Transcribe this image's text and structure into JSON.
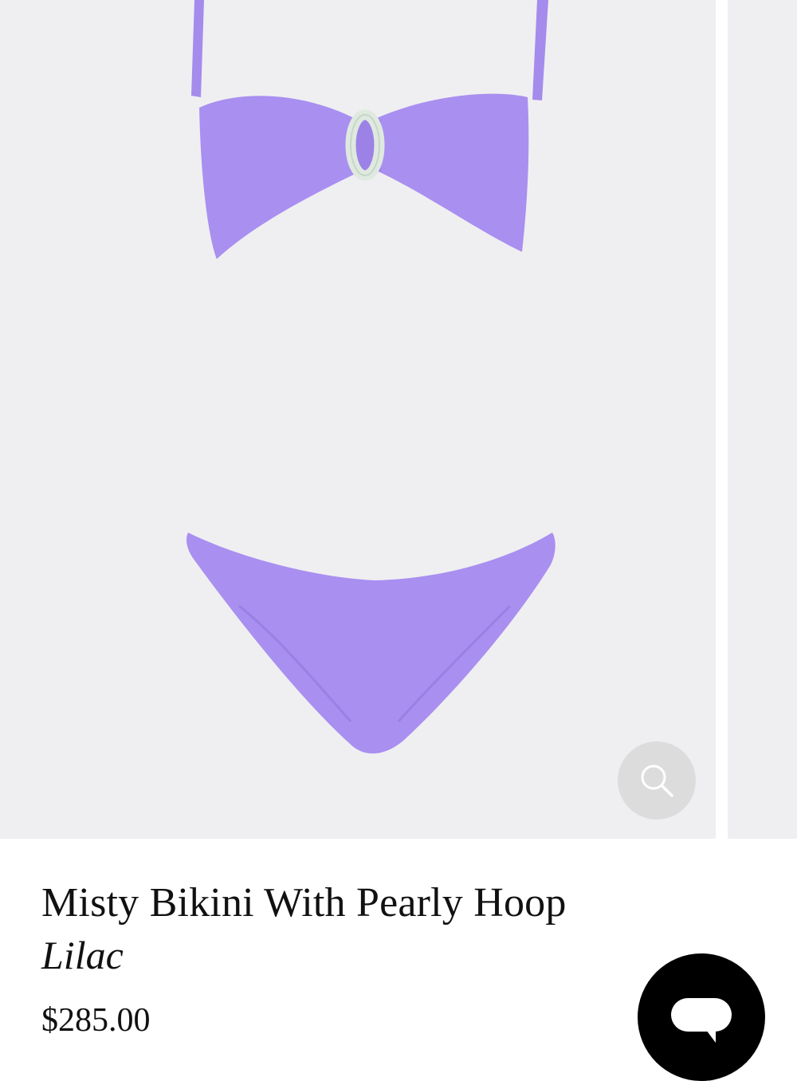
{
  "product": {
    "title": "Misty Bikini With Pearly Hoop",
    "color_name": "Lilac",
    "price": "$285.00"
  },
  "gallery": {
    "background_color": "#efeff1",
    "garment_color": "#a98ff0",
    "zoom_icon": "search-icon"
  },
  "chat": {
    "icon": "chat-bubble-icon",
    "background_color": "#000000"
  }
}
